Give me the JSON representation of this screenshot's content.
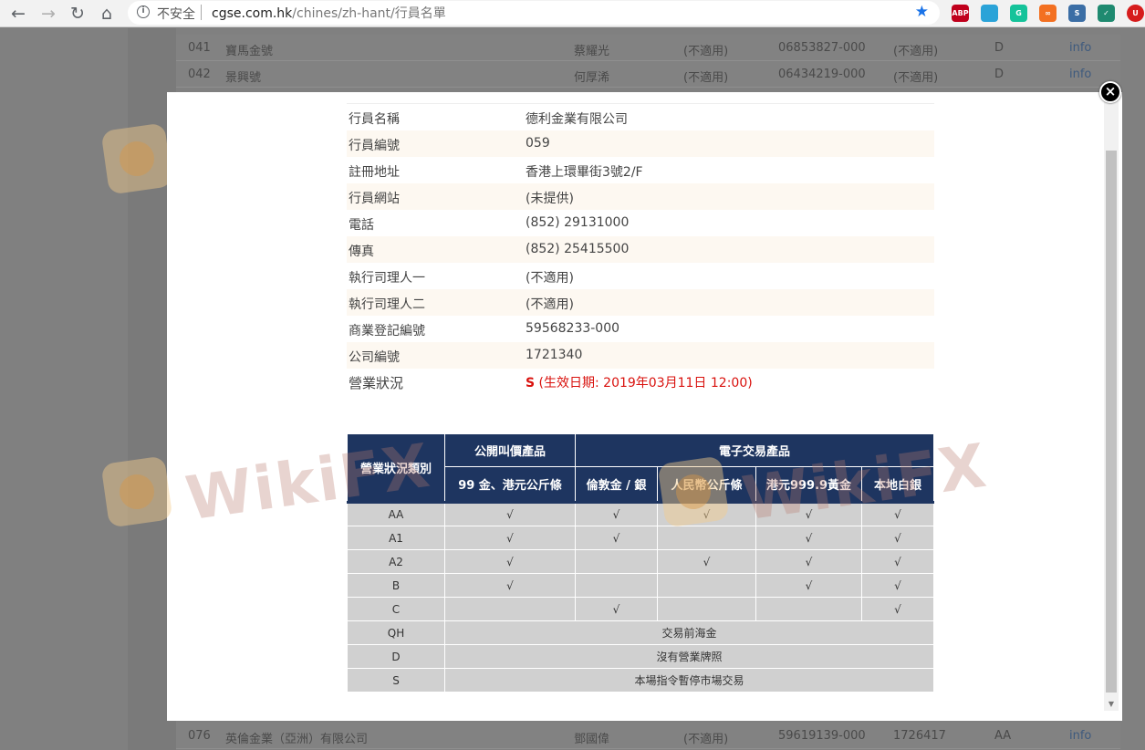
{
  "browser": {
    "security_label": "不安全",
    "url_host": "cgse.com.hk",
    "url_path": "/chines/zh-hant/行員名單",
    "extensions": [
      {
        "name": "abp",
        "label": "ABP",
        "color": "#c0001c"
      },
      {
        "name": "translate",
        "label": "",
        "color": "#2aa3d8"
      },
      {
        "name": "grammarly",
        "label": "G",
        "color": "#15c39a"
      },
      {
        "name": "infinity",
        "label": "∞",
        "color": "#f37021"
      },
      {
        "name": "s-ext",
        "label": "S",
        "color": "#3b6ea5"
      },
      {
        "name": "check-ext",
        "label": "✓",
        "color": "#1f8a70"
      },
      {
        "name": "ublock",
        "label": "U",
        "color": "#d61c1c"
      }
    ]
  },
  "background": {
    "rows": [
      {
        "no": "041",
        "name": "寶馬金號",
        "rep": "蔡耀光",
        "c1": "(不適用)",
        "br": "06853827-000",
        "c2": "(不適用)",
        "status": "D",
        "link": "info"
      },
      {
        "no": "042",
        "name": "景興號",
        "rep": "何厚浠",
        "c1": "(不適用)",
        "br": "06434219-000",
        "c2": "(不適用)",
        "status": "D",
        "link": "info"
      },
      {
        "no": "076",
        "name": "英倫金業（亞洲）有限公司",
        "rep": "鄧國偉",
        "c1": "(不適用)",
        "br": "59619139-000",
        "c2": "1726417",
        "status": "AA",
        "link": "info"
      }
    ]
  },
  "member": {
    "fields": [
      {
        "label": "行員名稱",
        "value": "德利金業有限公司"
      },
      {
        "label": "行員編號",
        "value": "059"
      },
      {
        "label": "註冊地址",
        "value": "香港上環畢街3號2/F"
      },
      {
        "label": "行員網站",
        "value": "(未提供)"
      },
      {
        "label": "電話",
        "value": "(852) 29131000"
      },
      {
        "label": "傳真",
        "value": "(852) 25415500"
      },
      {
        "label": "執行司理人一",
        "value": "(不適用)"
      },
      {
        "label": "執行司理人二",
        "value": "(不適用)"
      },
      {
        "label": "商業登記編號",
        "value": "59568233-000"
      },
      {
        "label": "公司編號",
        "value": "1721340"
      }
    ],
    "status_label": "營業狀況",
    "status_code": "S",
    "status_detail": "(生效日期: 2019年03月11日 12:00)",
    "status_color": "#d9120e"
  },
  "matrix": {
    "header_category": "營業狀況類別",
    "group_open_outcry": "公開叫價產品",
    "group_electronic": "電子交易產品",
    "columns": [
      "99 金、港元公斤條",
      "倫敦金 / 銀",
      "人民幣公斤條",
      "港元999.9黃金",
      "本地白銀"
    ],
    "rows": [
      {
        "code": "AA",
        "cells": [
          "√",
          "√",
          "√",
          "√",
          "√"
        ]
      },
      {
        "code": "A1",
        "cells": [
          "√",
          "√",
          "",
          "√",
          "√"
        ]
      },
      {
        "code": "A2",
        "cells": [
          "√",
          "",
          "√",
          "√",
          "√"
        ]
      },
      {
        "code": "B",
        "cells": [
          "√",
          "",
          "",
          "√",
          "√"
        ]
      },
      {
        "code": "C",
        "cells": [
          "",
          "√",
          "",
          "",
          "√"
        ]
      }
    ],
    "span_rows": [
      {
        "code": "QH",
        "text": "交易前海金"
      },
      {
        "code": "D",
        "text": "沒有營業牌照"
      },
      {
        "code": "S",
        "text": "本場指令暫停市場交易"
      }
    ],
    "header_color": "#1e3560"
  },
  "watermark": {
    "text": "WikiFX"
  }
}
